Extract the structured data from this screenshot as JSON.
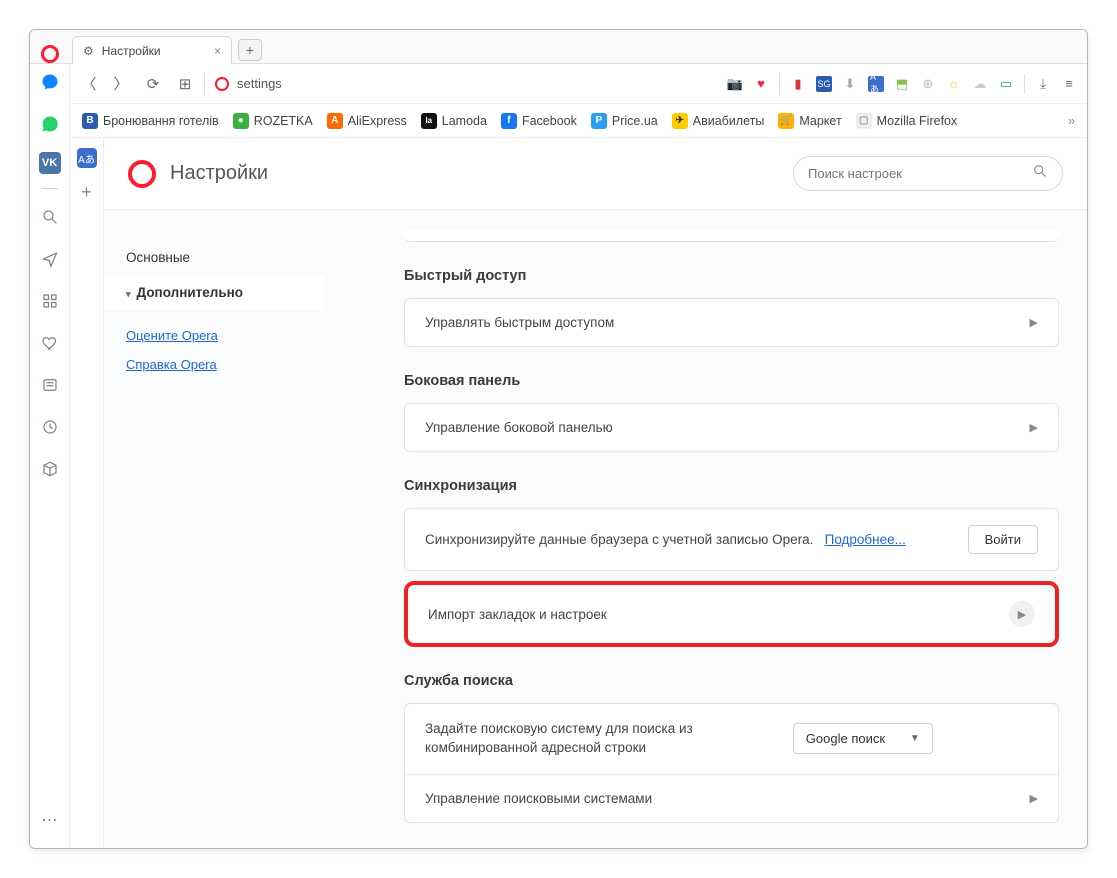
{
  "tab": {
    "title": "Настройки"
  },
  "addressbar": {
    "text": "settings"
  },
  "bookmarks": [
    {
      "label": "Бронювання готелів",
      "bg": "#2a5db0",
      "initial": "B"
    },
    {
      "label": "ROZETKA",
      "bg": "#3cb043",
      "initial": "●"
    },
    {
      "label": "AliExpress",
      "bg": "#ff6a00",
      "initial": "A"
    },
    {
      "label": "Lamoda",
      "bg": "#111",
      "initial": "la"
    },
    {
      "label": "Facebook",
      "bg": "#1877f2",
      "initial": "f"
    },
    {
      "label": "Price.ua",
      "bg": "#2a9df4",
      "initial": "P"
    },
    {
      "label": "Авиабилеты",
      "bg": "#ffcc00",
      "initial": "✈"
    },
    {
      "label": "Маркет",
      "bg": "#ffb300",
      "initial": "🛒"
    },
    {
      "label": "Mozilla Firefox",
      "bg": "#ddd",
      "initial": "📁"
    }
  ],
  "settings": {
    "title": "Настройки",
    "search_placeholder": "Поиск настроек",
    "nav": {
      "basic": "Основные",
      "advanced": "Дополнительно"
    },
    "links": {
      "rate": "Оцените Opera",
      "help": "Справка Opera"
    },
    "sections": {
      "speeddial": {
        "heading": "Быстрый доступ",
        "manage": "Управлять быстрым доступом"
      },
      "sidebar": {
        "heading": "Боковая панель",
        "manage": "Управление боковой панелью"
      },
      "sync": {
        "heading": "Синхронизация",
        "text": "Синхронизируйте данные браузера с учетной записью Opera.",
        "more": "Подробнее...",
        "login": "Войти",
        "import": "Импорт закладок и настроек"
      },
      "search": {
        "heading": "Служба поиска",
        "desc": "Задайте поисковую систему для поиска из комбинированной адресной строки",
        "engine": "Google поиск",
        "manage": "Управление поисковыми системами"
      }
    }
  }
}
